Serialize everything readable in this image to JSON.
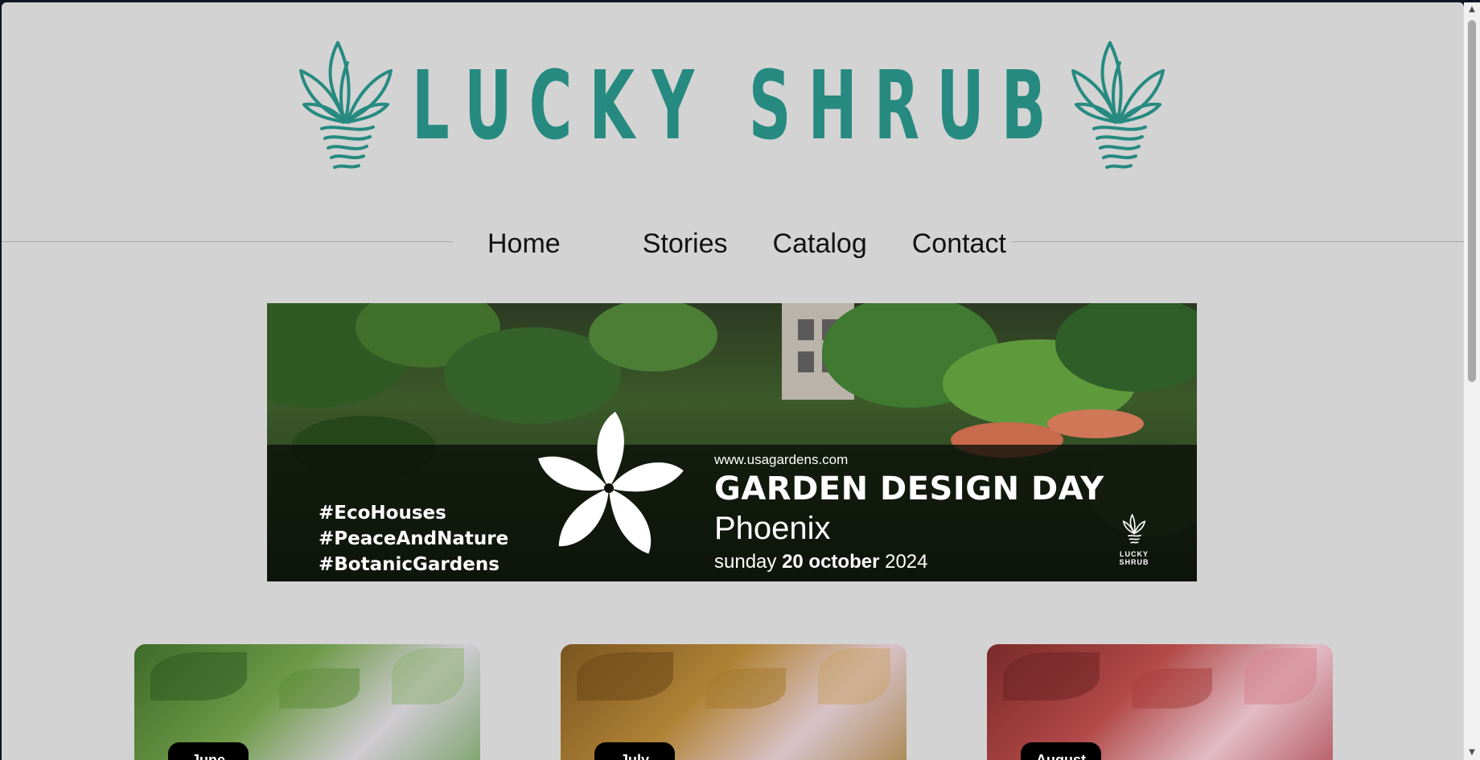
{
  "brand": {
    "name": "LUCKY SHRUB",
    "color": "#268a80",
    "logo_icon": "potted-plant-icon"
  },
  "nav": {
    "items": [
      {
        "label": "Home"
      },
      {
        "label": "Stories"
      },
      {
        "label": "Catalog"
      },
      {
        "label": "Contact"
      }
    ]
  },
  "banner": {
    "tags": [
      "#EcoHouses",
      "#PeaceAndNature",
      "#BotanicGardens"
    ],
    "website": "www.usagardens.com",
    "headline": "GARDEN DESIGN DAY",
    "city": "Phoenix",
    "date_prefix": "sunday",
    "date_bold": "20 october",
    "date_year": "2024",
    "mini_logo_line1": "LUCKY",
    "mini_logo_line2": "SHRUB"
  },
  "cards": [
    {
      "month": "June"
    },
    {
      "month": "July"
    },
    {
      "month": "August"
    }
  ],
  "scrollbar": {
    "up_icon": "chevron-up-icon",
    "down_icon": "chevron-down-icon"
  }
}
